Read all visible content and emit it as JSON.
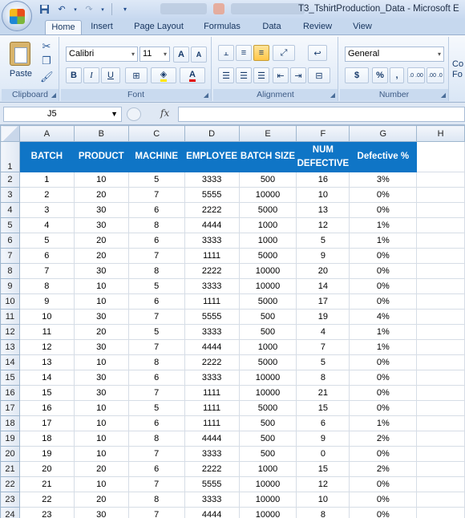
{
  "window": {
    "title": "T3_TshirtProduction_Data - Microsoft E"
  },
  "ribbon": {
    "tabs": [
      {
        "label": "Home",
        "active": true
      },
      {
        "label": "Insert",
        "active": false
      },
      {
        "label": "Page Layout",
        "active": false
      },
      {
        "label": "Formulas",
        "active": false
      },
      {
        "label": "Data",
        "active": false
      },
      {
        "label": "Review",
        "active": false
      },
      {
        "label": "View",
        "active": false
      }
    ],
    "clipboard": {
      "paste_label": "Paste",
      "group_label": "Clipboard"
    },
    "font": {
      "font_name": "Calibri",
      "font_size": "11",
      "grow_label": "A",
      "shrink_label": "A",
      "bold": "B",
      "italic": "I",
      "underline": "U",
      "font_color_label": "A",
      "group_label": "Font"
    },
    "alignment": {
      "group_label": "Alignment"
    },
    "number": {
      "format": "General",
      "currency": "$",
      "percent": "%",
      "comma": ",",
      "increase_decimal": ".0 .00",
      "decrease_decimal": ".00 .0",
      "group_label": "Number"
    },
    "cut_off_label": "Co\nFo"
  },
  "formula_bar": {
    "name_box": "J5",
    "fx_label": "fx",
    "formula": ""
  },
  "sheet": {
    "columns": [
      "A",
      "B",
      "C",
      "D",
      "E",
      "F",
      "G",
      "H"
    ],
    "headers": [
      "BATCH",
      "PRODUCT",
      "MACHINE",
      "EMPLOYEE",
      "BATCH SIZE",
      "NUM DEFECTIVE",
      "Defective %"
    ],
    "header_color": "#0f75c6",
    "rows": [
      [
        "1",
        "10",
        "5",
        "3333",
        "500",
        "16",
        "3%"
      ],
      [
        "2",
        "20",
        "7",
        "5555",
        "10000",
        "10",
        "0%"
      ],
      [
        "3",
        "30",
        "6",
        "2222",
        "5000",
        "13",
        "0%"
      ],
      [
        "4",
        "30",
        "8",
        "4444",
        "1000",
        "12",
        "1%"
      ],
      [
        "5",
        "20",
        "6",
        "3333",
        "1000",
        "5",
        "1%"
      ],
      [
        "6",
        "20",
        "7",
        "1111",
        "5000",
        "9",
        "0%"
      ],
      [
        "7",
        "30",
        "8",
        "2222",
        "10000",
        "20",
        "0%"
      ],
      [
        "8",
        "10",
        "5",
        "3333",
        "10000",
        "14",
        "0%"
      ],
      [
        "9",
        "10",
        "6",
        "1111",
        "5000",
        "17",
        "0%"
      ],
      [
        "10",
        "30",
        "7",
        "5555",
        "500",
        "19",
        "4%"
      ],
      [
        "11",
        "20",
        "5",
        "3333",
        "500",
        "4",
        "1%"
      ],
      [
        "12",
        "30",
        "7",
        "4444",
        "1000",
        "7",
        "1%"
      ],
      [
        "13",
        "10",
        "8",
        "2222",
        "5000",
        "5",
        "0%"
      ],
      [
        "14",
        "30",
        "6",
        "3333",
        "10000",
        "8",
        "0%"
      ],
      [
        "15",
        "30",
        "7",
        "1111",
        "10000",
        "21",
        "0%"
      ],
      [
        "16",
        "10",
        "5",
        "1111",
        "5000",
        "15",
        "0%"
      ],
      [
        "17",
        "10",
        "6",
        "1111",
        "500",
        "6",
        "1%"
      ],
      [
        "18",
        "10",
        "8",
        "4444",
        "500",
        "9",
        "2%"
      ],
      [
        "19",
        "10",
        "7",
        "3333",
        "500",
        "0",
        "0%"
      ],
      [
        "20",
        "20",
        "6",
        "2222",
        "1000",
        "15",
        "2%"
      ],
      [
        "21",
        "10",
        "7",
        "5555",
        "10000",
        "12",
        "0%"
      ],
      [
        "22",
        "20",
        "8",
        "3333",
        "10000",
        "10",
        "0%"
      ],
      [
        "23",
        "30",
        "7",
        "4444",
        "10000",
        "8",
        "0%"
      ]
    ]
  }
}
